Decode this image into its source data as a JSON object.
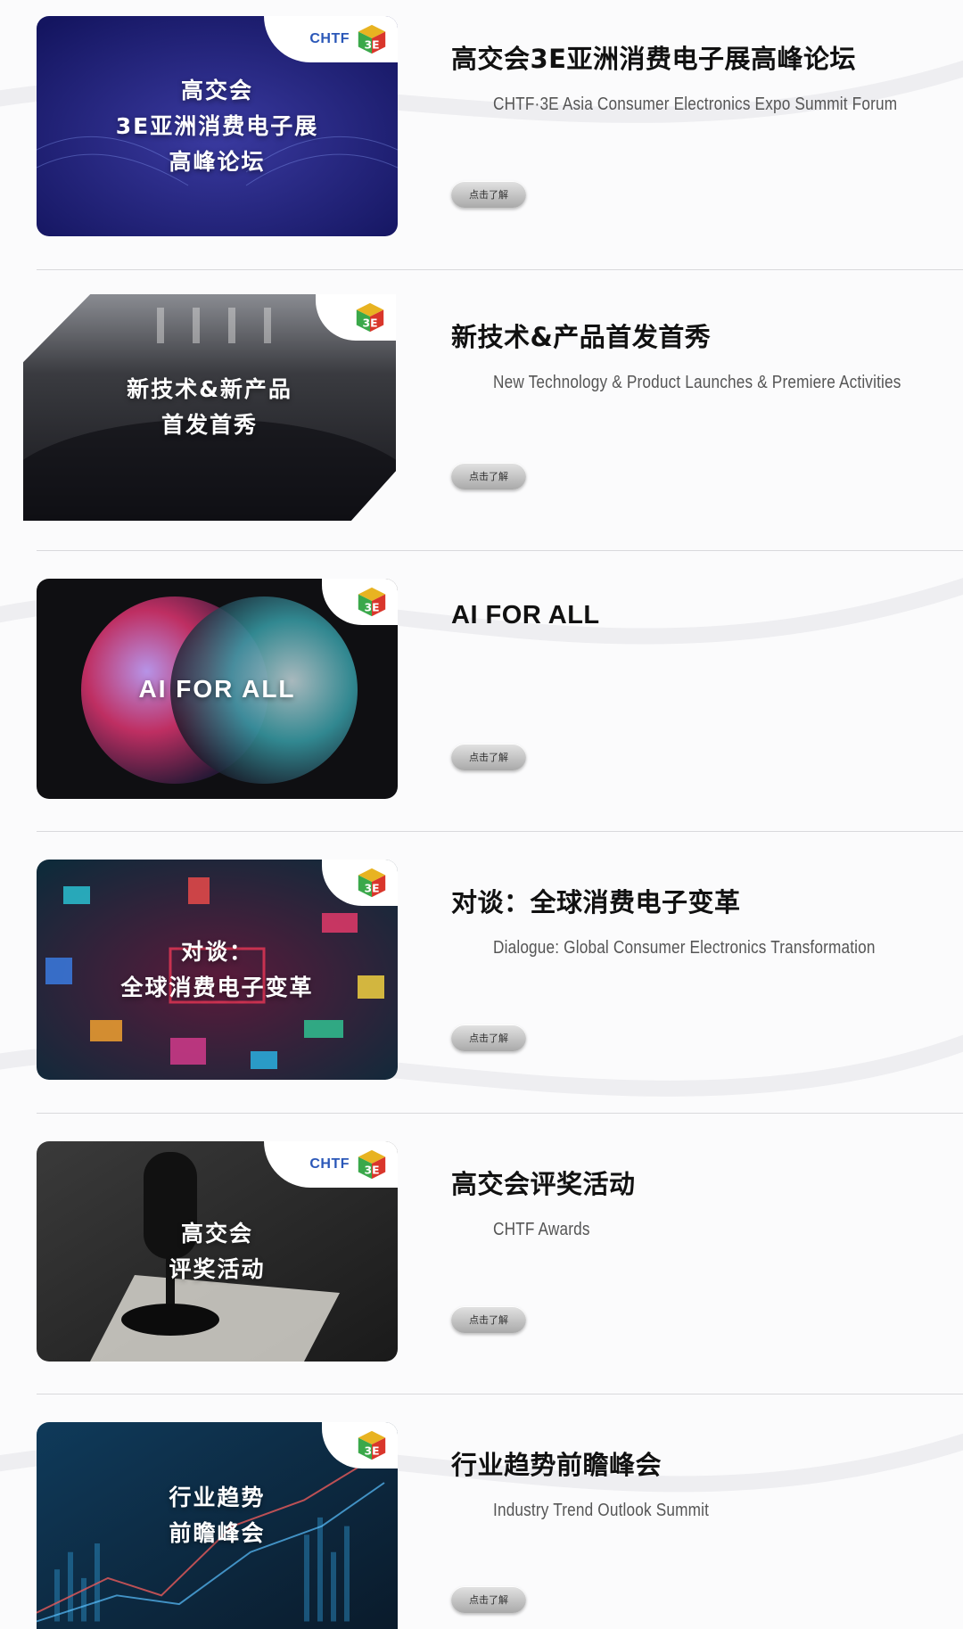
{
  "items": [
    {
      "title": "高交会3E亚洲消费电子展高峰论坛",
      "subtitle": "CHTF·3E Asia Consumer Electronics Expo Summit Forum",
      "button": "点击了解",
      "image_text_1": "高交会",
      "image_text_2": "3E亚洲消费电子展",
      "image_text_3": "高峰论坛",
      "logo_text": "CHTF",
      "badge": "3E"
    },
    {
      "title": "新技术&产品首发首秀",
      "subtitle": "New Technology & Product Launches & Premiere Activities",
      "button": "点击了解",
      "image_text_1": "新技术&新产品",
      "image_text_2": "首发首秀",
      "badge": "3E"
    },
    {
      "title": "AI FOR ALL",
      "subtitle": "",
      "button": "点击了解",
      "image_text_1": "AI FOR ALL",
      "badge": "3E"
    },
    {
      "title": "对谈：全球消费电子变革",
      "subtitle": "Dialogue: Global Consumer Electronics Transformation",
      "button": "点击了解",
      "image_text_1": "对谈：",
      "image_text_2": "全球消费电子变革",
      "badge": "3E"
    },
    {
      "title": "高交会评奖活动",
      "subtitle": "CHTF Awards",
      "button": "点击了解",
      "image_text_1": "高交会",
      "image_text_2": "评奖活动",
      "logo_text": "CHTF",
      "badge": "3E"
    },
    {
      "title": "行业趋势前瞻峰会",
      "subtitle": "Industry Trend Outlook Summit",
      "button": "点击了解",
      "image_text_1": "行业趋势",
      "image_text_2": "前瞻峰会",
      "badge": "3E"
    }
  ],
  "colors": {
    "title": "#111111",
    "subtitle": "#555555",
    "logo_blue": "#2a57b8"
  }
}
